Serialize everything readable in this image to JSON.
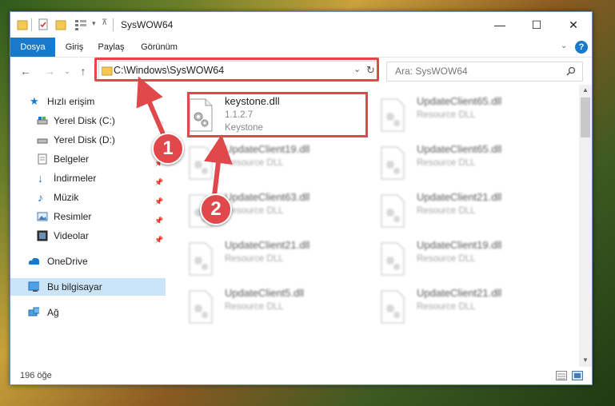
{
  "window": {
    "title": "SysWOW64",
    "controls": {
      "minimize": "—",
      "maximize": "☐",
      "close": "✕"
    }
  },
  "ribbon": {
    "tabs": [
      {
        "label": "Dosya",
        "active": true
      },
      {
        "label": "Giriş"
      },
      {
        "label": "Paylaş"
      },
      {
        "label": "Görünüm"
      }
    ],
    "help": "?"
  },
  "address": {
    "path": "C:\\Windows\\SysWOW64",
    "search_placeholder": "Ara: SysWOW64"
  },
  "sidebar": {
    "items": [
      {
        "label": "Hızlı erişim",
        "icon": "star-icon"
      },
      {
        "label": "Yerel Disk (C:)",
        "icon": "drive-icon",
        "pinned": true
      },
      {
        "label": "Yerel Disk (D:)",
        "icon": "drive-icon",
        "pinned": true
      },
      {
        "label": "Belgeler",
        "icon": "documents-icon",
        "pinned": true
      },
      {
        "label": "İndirmeler",
        "icon": "download-icon",
        "pinned": true
      },
      {
        "label": "Müzik",
        "icon": "music-icon",
        "pinned": true
      },
      {
        "label": "Resimler",
        "icon": "pictures-icon",
        "pinned": true
      },
      {
        "label": "Videolar",
        "icon": "videos-icon",
        "pinned": true
      },
      {
        "label": "OneDrive",
        "icon": "cloud-icon"
      },
      {
        "label": "Bu bilgisayar",
        "icon": "computer-icon",
        "selected": true
      },
      {
        "label": "Ağ",
        "icon": "network-icon"
      }
    ]
  },
  "files": [
    {
      "name": "keystone.dll",
      "line1": "1.1.2.7",
      "line2": "Keystone",
      "highlighted": true
    },
    {
      "name": "UpdateClient65.dll",
      "line1": "Resource DLL"
    },
    {
      "name": "UpdateClient19.dll",
      "line1": "Resource DLL"
    },
    {
      "name": "UpdateClient65.dll",
      "line1": "Resource DLL"
    },
    {
      "name": "UpdateClient63.dll",
      "line1": "Resource DLL"
    },
    {
      "name": "UpdateClient21.dll",
      "line1": "Resource DLL"
    },
    {
      "name": "UpdateClient21.dll",
      "line1": "Resource DLL"
    },
    {
      "name": "UpdateClient19.dll",
      "line1": "Resource DLL"
    },
    {
      "name": "UpdateClient5.dll",
      "line1": "Resource DLL"
    },
    {
      "name": "UpdateClient21.dll",
      "line1": "Resource DLL"
    }
  ],
  "status": {
    "count": "196 öğe"
  },
  "annotations": {
    "step1": "1",
    "step2": "2",
    "color": "#e0484c"
  }
}
